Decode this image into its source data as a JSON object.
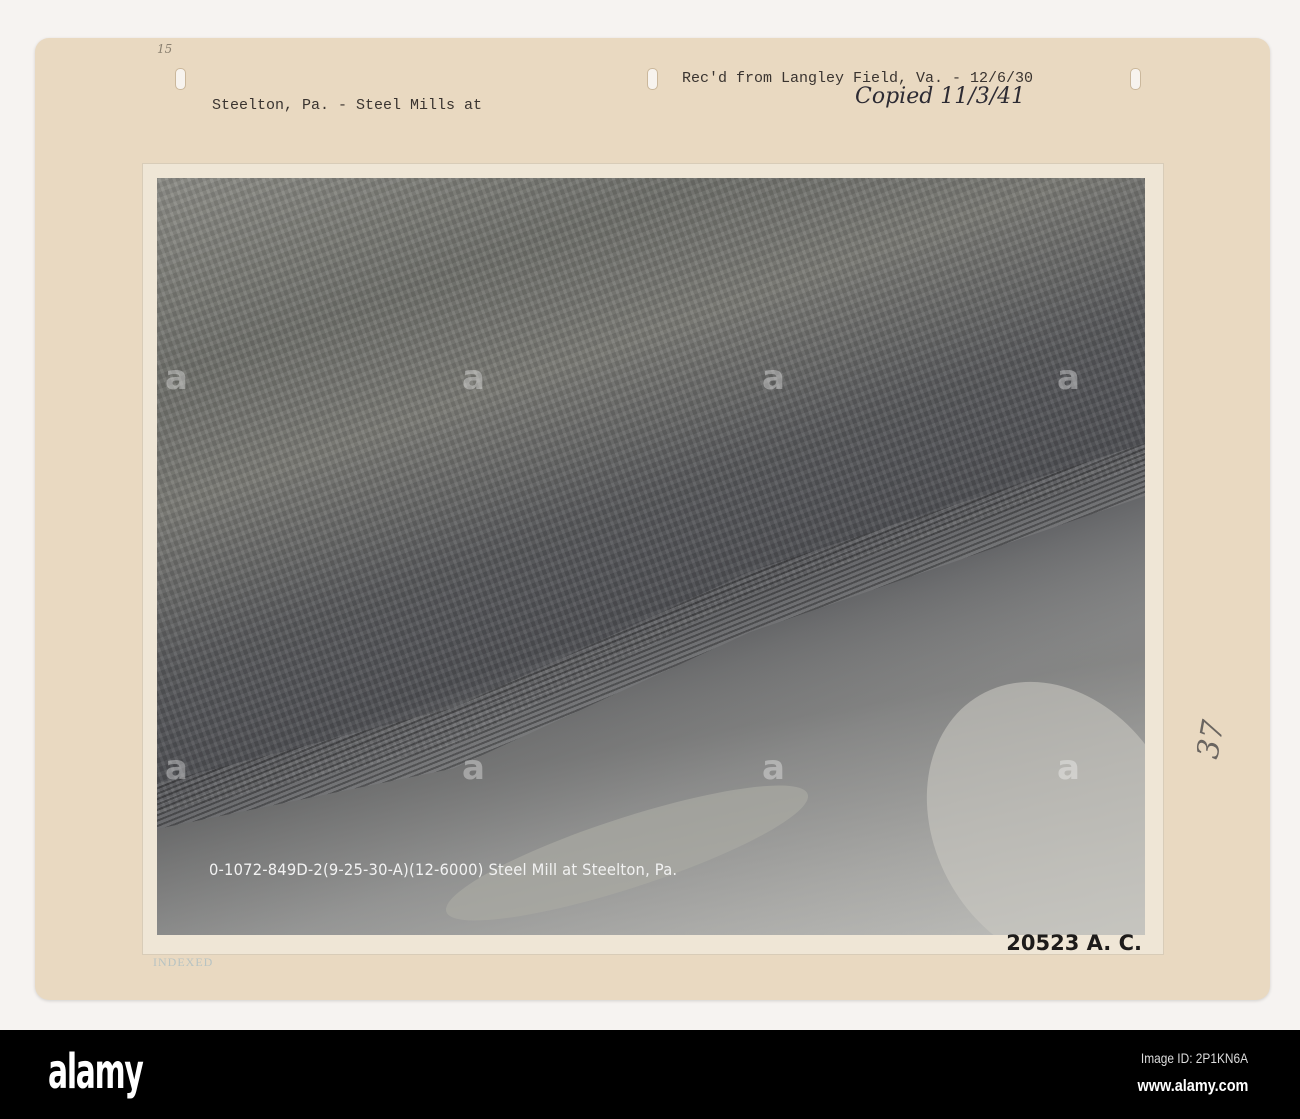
{
  "card": {
    "title_left": "Steelton, Pa. - Steel Mills at",
    "received": "Rec'd from Langley Field, Va. - 12/6/30",
    "copied": "Copied 11/3/41",
    "pencil_mark": "37",
    "corner_mark": "15",
    "stamp": "INDEXED"
  },
  "photo": {
    "caption": "0-1072-849D-2(9-25-30-A)(12-6000) Steel Mill at Steelton, Pa.",
    "watermark": "a",
    "number": "20523 A. C."
  },
  "footer": {
    "logo": "alamy",
    "image_id": "Image ID: 2P1KN6A",
    "url": "www.alamy.com"
  }
}
